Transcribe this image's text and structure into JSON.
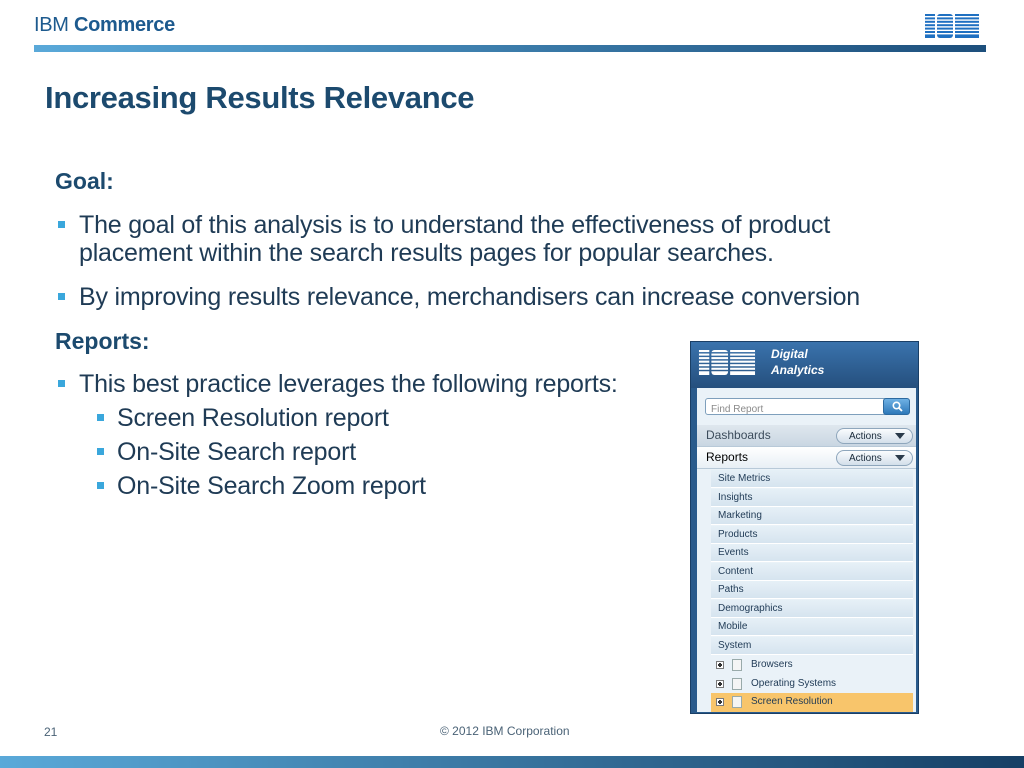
{
  "header": {
    "brand_prefix": "IBM",
    "brand_name": "Commerce",
    "logo": "ibm-striped-logo"
  },
  "colors": {
    "title": "#1c4a6e",
    "bullet_marker": "#3aa7dc",
    "bar_start": "#5aa9d9",
    "bar_end": "#1d4f7c",
    "selection": "#f8c56b"
  },
  "slide": {
    "title": "Increasing Results Relevance",
    "goal_heading": "Goal:",
    "goal_bullets": [
      "The goal of this analysis is to understand the effectiveness of product placement within the search results pages for popular searches.",
      "By improving results relevance, merchandisers can increase conversion"
    ],
    "reports_heading": "Reports:",
    "reports_bullet": "This best practice leverages the following reports:",
    "report_list": [
      "Screen Resolution report",
      "On-Site Search report",
      "On-Site Search Zoom report"
    ]
  },
  "panel": {
    "logo": "ibm-striped-logo",
    "product_line1": "Digital",
    "product_line2": "Analytics",
    "search_placeholder": "Find Report",
    "search_icon": "magnifier-icon",
    "nav": [
      {
        "label": "Dashboards",
        "action": "Actions"
      },
      {
        "label": "Reports",
        "action": "Actions"
      }
    ],
    "report_items": [
      "Site Metrics",
      "Insights",
      "Marketing",
      "Products",
      "Events",
      "Content",
      "Paths",
      "Demographics",
      "Mobile",
      "System"
    ],
    "system_children": [
      {
        "label": "Browsers",
        "selected": false
      },
      {
        "label": "Operating Systems",
        "selected": false
      },
      {
        "label": "Screen Resolution",
        "selected": true
      }
    ]
  },
  "footer": {
    "page_number": "21",
    "copyright": "© 2012 IBM Corporation"
  }
}
